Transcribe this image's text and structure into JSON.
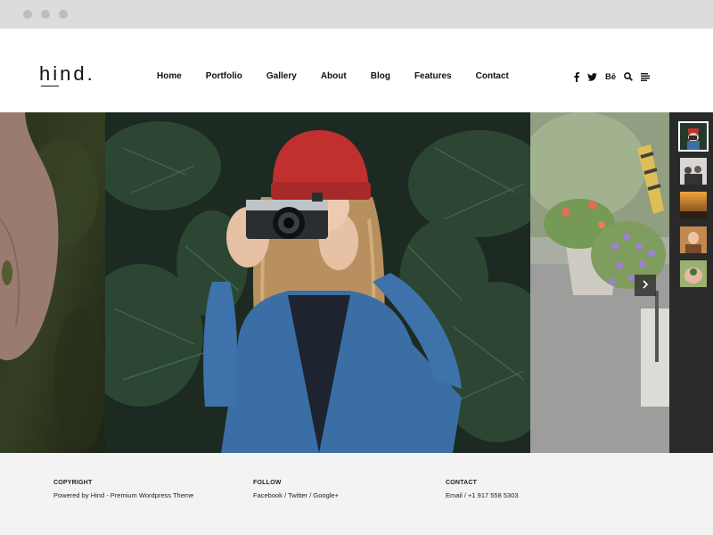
{
  "window": {
    "dots": [
      "close-dot",
      "minimize-dot",
      "maximize-dot"
    ]
  },
  "header": {
    "logo": "hind.",
    "nav": [
      "Home",
      "Portfolio",
      "Gallery",
      "About",
      "Blog",
      "Features",
      "Contact"
    ],
    "social_icons": [
      "facebook-icon",
      "twitter-icon",
      "behance-icon",
      "search-icon",
      "menu-icon"
    ],
    "behance_label": "Bē"
  },
  "gallery": {
    "slides": [
      "hand-photo",
      "woman-with-camera-photo",
      "flower-pots-photo"
    ],
    "thumbnails": [
      "woman-camera-thumb",
      "team-thumb",
      "sunset-thumb",
      "portrait-thumb",
      "hands-plant-thumb"
    ],
    "active_thumbnail": 0,
    "next_icon": "chevron-right-icon"
  },
  "footer": {
    "copyright": {
      "heading": "COPYRIGHT",
      "prefix": "Powered by ",
      "text": "Hind - Premium Wordpress Theme"
    },
    "follow": {
      "heading": "FOLLOW",
      "links": [
        "Facebook",
        "Twitter",
        "Google+"
      ],
      "separator": " / "
    },
    "contact": {
      "heading": "CONTACT",
      "email": "Email",
      "separator": " / ",
      "phone": "+1 917 558 5303"
    }
  },
  "colors": {
    "chrome": "#dcdcdc",
    "footer_bg": "#f3f3f3",
    "thumb_strip": "#2a2a2a",
    "beanie": "#c0302f",
    "denim": "#3a6ea5"
  }
}
